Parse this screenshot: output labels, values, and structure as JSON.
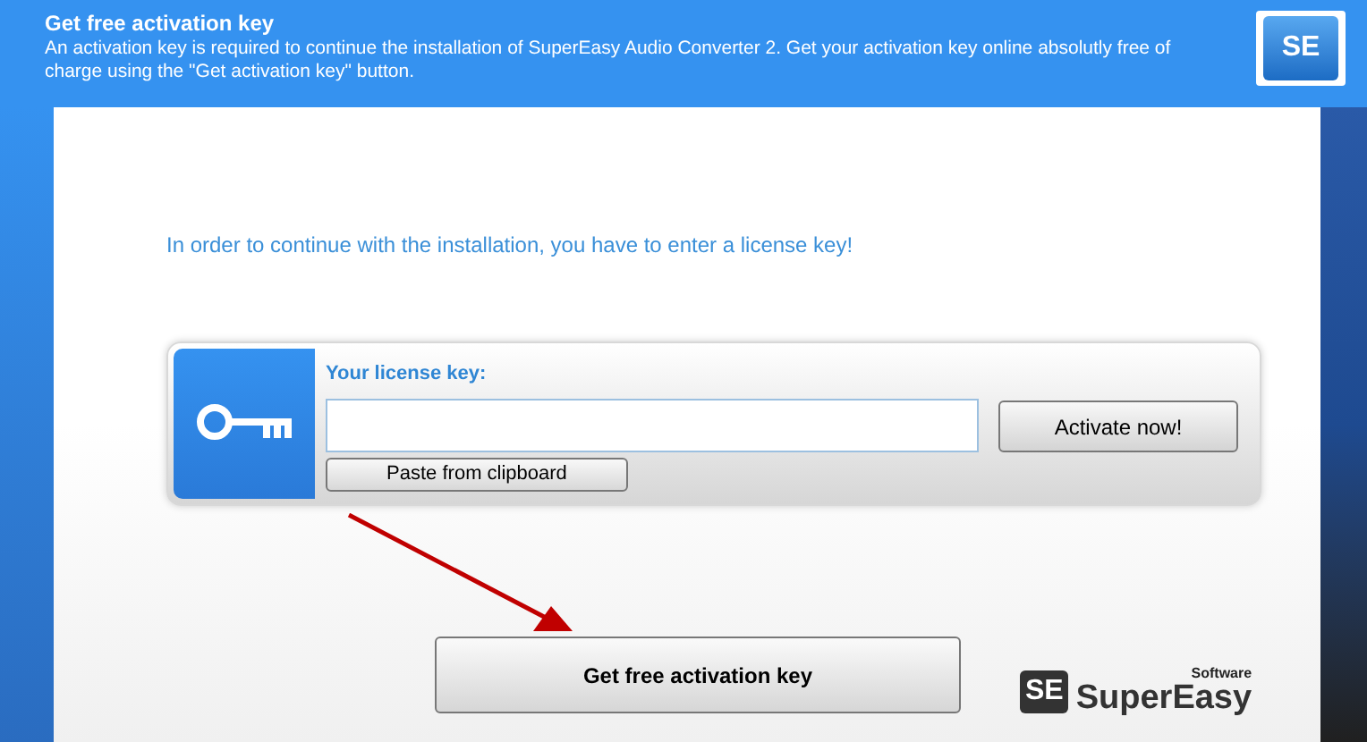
{
  "header": {
    "title": "Get free activation key",
    "description": "An activation key is required to continue the installation of SuperEasy Audio Converter 2. Get your activation key online absolutly free of charge using the \"Get activation key\" button.",
    "logo_text": "SE"
  },
  "notice": "In order to continue with the installation, you have to enter a license key!",
  "license": {
    "label": "Your license key:",
    "activate_button": "Activate now!",
    "paste_button": "Paste from clipboard"
  },
  "main_button": "Get free activation key",
  "brand": {
    "mark": "SE",
    "name": "SuperEasy",
    "tagline": "Software"
  }
}
